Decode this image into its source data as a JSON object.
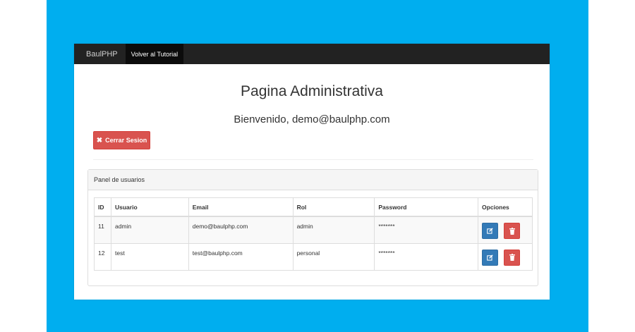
{
  "navbar": {
    "brand": "BaulPHP",
    "link": "Volver al Tutorial"
  },
  "page": {
    "title": "Pagina Administrativa",
    "welcome": "Bienvenido, demo@baulphp.com",
    "logout_label": "Cerrar Sesion"
  },
  "panel": {
    "heading": "Panel de usuarios",
    "columns": [
      "ID",
      "Usuario",
      "Email",
      "Rol",
      "Password",
      "Opciones"
    ],
    "rows": [
      {
        "id": "11",
        "usuario": "admin",
        "email": "demo@baulphp.com",
        "rol": "admin",
        "password": "*******"
      },
      {
        "id": "12",
        "usuario": "test",
        "email": "test@baulphp.com",
        "rol": "personal",
        "password": "*******"
      }
    ]
  },
  "colors": {
    "background": "#00aeef",
    "navbar": "#222222",
    "danger": "#d9534f",
    "primary": "#337ab7"
  },
  "icons": {
    "logout": "close-icon",
    "edit": "edit-icon",
    "delete": "trash-icon"
  }
}
